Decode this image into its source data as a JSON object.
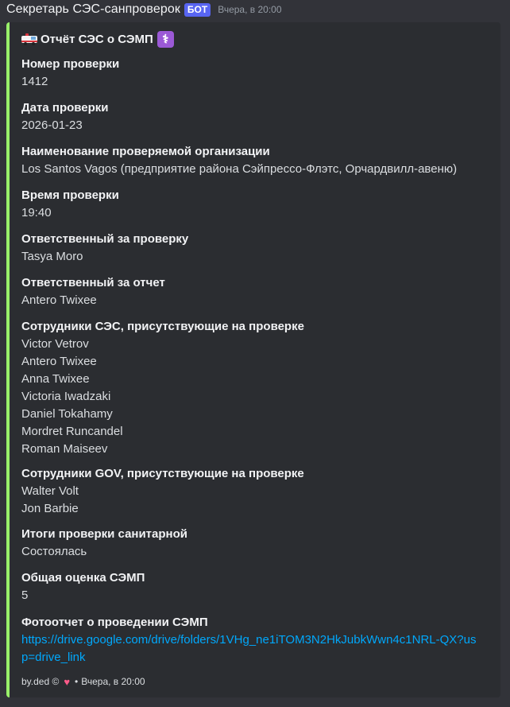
{
  "message": {
    "author": "Секретарь СЭС-санпроверок",
    "bot_tag": "БОТ",
    "timestamp": "Вчера, в 20:00"
  },
  "embed": {
    "accent_color": "#99f06a",
    "title": "Отчёт СЭС о СЭМП",
    "title_icons": [
      "ambulance-icon",
      "medical-symbol-icon"
    ],
    "fields": [
      {
        "name": "Номер проверки",
        "value": [
          "1412"
        ]
      },
      {
        "name": "Дата проверки",
        "value": [
          "2026-01-23"
        ]
      },
      {
        "name": "Наименование проверяемой организации",
        "value": [
          "Los Santos Vagos (предприятие района Сэйпрессо-Флэтс, Орчардвилл-авеню)"
        ]
      },
      {
        "name": "Время проверки",
        "value": [
          "19:40"
        ]
      },
      {
        "name": "Ответственный за проверку",
        "value": [
          "Tasya Moro"
        ]
      },
      {
        "name": "Ответственный за отчет",
        "value": [
          "Antero Twixee"
        ]
      },
      {
        "name": "Сотрудники СЭС, присутствующие на проверке",
        "value": [
          "Victor Vetrov",
          "Antero Twixee",
          "Anna Twixee",
          "Victoria Iwadzaki",
          "Daniel Tokahamy",
          "Mordret Runcandel",
          "Roman Maiseev"
        ]
      },
      {
        "name": "Сотрудники GOV, присутствующие на проверке",
        "value": [
          "Walter Volt",
          "Jon Barbie"
        ]
      },
      {
        "name": "Итоги проверки санитарной",
        "value": [
          "Состоялась"
        ]
      },
      {
        "name": "Общая оценка СЭМП",
        "value": [
          "5"
        ]
      },
      {
        "name": "Фотоотчет о проведении СЭМП",
        "value": [
          "https://drive.google.com/drive/folders/1VHg_ne1iTOM3N2HkJubkWwn4c1NRL-QX?usp=drive_link"
        ],
        "is_link": true
      }
    ],
    "footer": {
      "text": "by.ded ©",
      "icon": "heart-icon",
      "separator": "•",
      "timestamp": "Вчера, в 20:00"
    }
  }
}
